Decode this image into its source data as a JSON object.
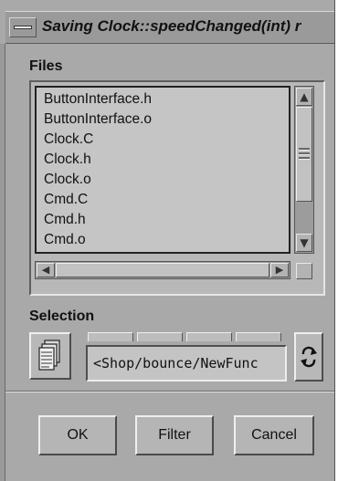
{
  "window": {
    "title": "Saving Clock::speedChanged(int) r"
  },
  "files": {
    "label": "Files",
    "items": [
      "ButtonInterface.h",
      "ButtonInterface.o",
      "Clock.C",
      "Clock.h",
      "Clock.o",
      "Cmd.C",
      "Cmd.h",
      "Cmd.o"
    ]
  },
  "selection": {
    "label": "Selection",
    "value": "<Shop/bounce/NewFunc"
  },
  "buttons": {
    "ok": "OK",
    "filter": "Filter",
    "cancel": "Cancel"
  },
  "icons": {
    "window_menu": "window-menu-icon",
    "documents": "documents-icon",
    "cycle": "cycle-arrows-icon"
  },
  "colors": {
    "background": "#a9a9a9",
    "list_background": "#c5c5c5"
  }
}
